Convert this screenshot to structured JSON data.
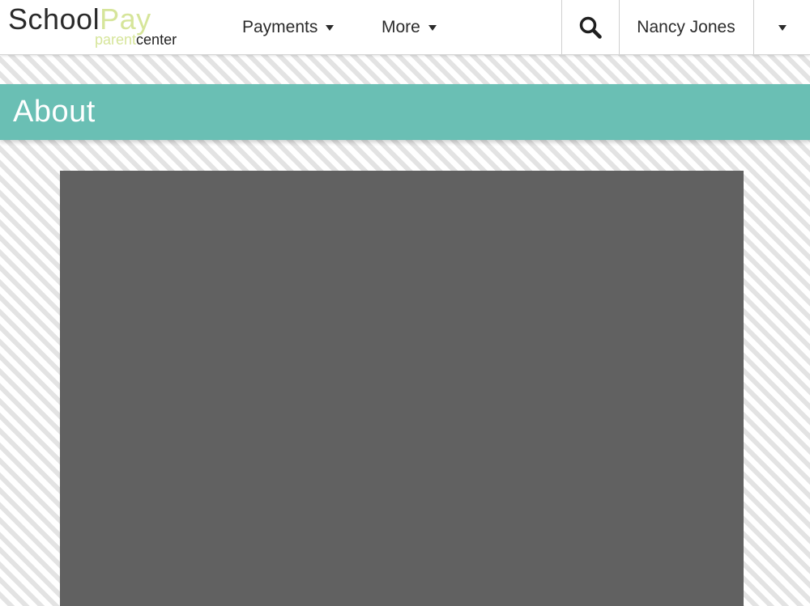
{
  "brand": {
    "name_part1": "School",
    "name_part2": "Pay",
    "sub_part1": "parent",
    "sub_part2": "center"
  },
  "nav": {
    "items": [
      {
        "label": "Payments"
      },
      {
        "label": "More"
      }
    ]
  },
  "header": {
    "search_icon": "search-icon",
    "user_name": "Nancy Jones"
  },
  "page": {
    "title": "About"
  },
  "colors": {
    "banner": "#6abfb4",
    "brand_accent": "#d6e59a",
    "content_panel": "#616161"
  }
}
